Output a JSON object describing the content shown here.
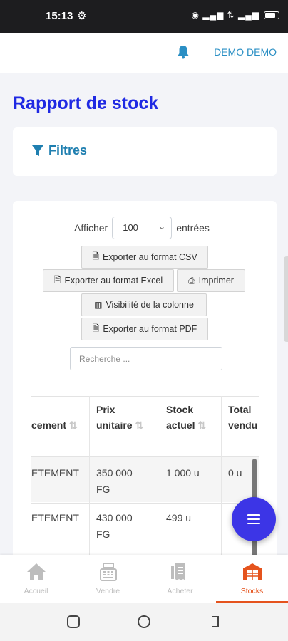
{
  "status_bar": {
    "time": "15:13",
    "icons": "⊚ 5G ⇅ ⁿ ⊙ ⫴ ⸱⊂"
  },
  "header": {
    "user_name": "DEMO DEMO"
  },
  "page": {
    "title": "Rapport de stock"
  },
  "filters": {
    "label": "Filtres"
  },
  "table_controls": {
    "show_label": "Afficher",
    "page_size": "100",
    "entries_label": "entrées",
    "buttons": {
      "csv": "Exporter au format CSV",
      "excel": "Exporter au format Excel",
      "print": "Imprimer",
      "columns": "Visibilité de la colonne",
      "pdf": "Exporter au format PDF"
    },
    "search_placeholder": "Recherche ..."
  },
  "table": {
    "columns": [
      "cement",
      "Prix unitaire",
      "Stock actuel",
      "Total vendu"
    ],
    "column_lines": {
      "prix": [
        "Prix",
        "unitaire"
      ],
      "stock": [
        "Stock",
        "actuel"
      ],
      "total": [
        "Total",
        "vendu"
      ]
    },
    "rows": [
      {
        "emplacement": "ETEMENT",
        "prix_1": "350 000",
        "prix_2": "FG",
        "stock": "1 000 u",
        "total": "0 u"
      },
      {
        "emplacement": "ETEMENT",
        "prix_1": "430 000",
        "prix_2": "FG",
        "stock": "499 u",
        "total": ""
      }
    ]
  },
  "bottom_nav": [
    {
      "label": "Accueil",
      "icon": "home-icon",
      "active": false
    },
    {
      "label": "Vendre",
      "icon": "cash-register-icon",
      "active": false
    },
    {
      "label": "Acheter",
      "icon": "receipt-icon",
      "active": false
    },
    {
      "label": "Stocks",
      "icon": "warehouse-icon",
      "active": true
    }
  ],
  "colors": {
    "title": "#1f29e3",
    "link": "#2a8fc4",
    "accent": "#e5531d",
    "fab": "#3c35e6"
  }
}
